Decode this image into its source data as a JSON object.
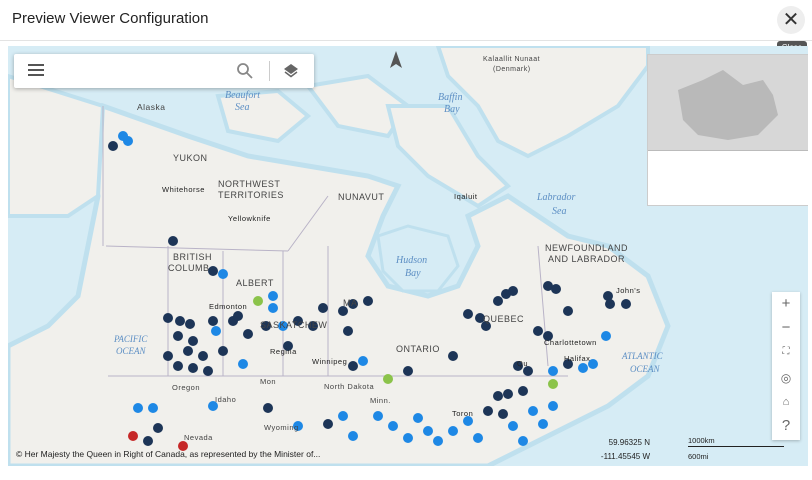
{
  "dialog": {
    "title": "Preview Viewer Configuration",
    "close_icon": "close-icon",
    "close_tooltip": "Close"
  },
  "map": {
    "menu_icon": "hamburger-menu-icon",
    "search_icon": "search-icon",
    "layers_icon": "layers-icon",
    "north_arrow_icon": "north-arrow-icon",
    "attribution": "© Her Majesty the Queen in Right of Canada, as represented by the Minister of...",
    "coordinates": {
      "lat": "59.96325 N",
      "lon": "-111.45545 W"
    },
    "scale": {
      "metric": "1000km",
      "imperial": "600mi"
    },
    "zoom_in_label": "+",
    "zoom_out_label": "−",
    "help_label": "?",
    "labels": {
      "alaska": "Alaska",
      "yukon": "YUKON",
      "whitehorse": "Whitehorse",
      "nwt1": "NORTHWEST",
      "nwt2": "TERRITORIES",
      "nunavut": "NUNAVUT",
      "iqaluit": "Iqaluit",
      "yellowknife": "Yellowknife",
      "bc1": "BRITISH",
      "bc2": "COLUMB",
      "alberta": "ALBERT",
      "edmonton": "Edmonton",
      "sask": "SASKATCHEW",
      "manitoba": "MA",
      "regina": "Regina",
      "winnipeg": "Winnipeg",
      "ontario": "ONTARIO",
      "quebec": "QUEBEC",
      "nl1": "NEWFOUNDLAND",
      "nl2": "AND LABRADOR",
      "johns": "John's",
      "charlottetown": "Charlottetown",
      "halifax": "Halifax",
      "quebec_city": "Qu",
      "montana": "Mon",
      "north_dakota": "North Dakota",
      "minn": "Minn.",
      "idaho": "Idaho",
      "oregon": "Oregon",
      "nevada": "Nevada",
      "wyoming": "Wyoming",
      "toronto": "Toron",
      "kalaallit1": "Kalaallit Nunaat",
      "kalaallit2": "(Denmark)"
    },
    "water_labels": {
      "beaufort1": "Beaufort",
      "beaufort2": "Sea",
      "baffin1": "Baffin",
      "baffin2": "Bay",
      "labrador1": "Labrador",
      "labrador2": "Sea",
      "hudson1": "Hudson",
      "hudson2": "Bay",
      "pacific1": "PACIFIC",
      "pacific2": "OCEAN",
      "atlantic1": "ATLANTIC",
      "atlantic2": "OCEAN"
    },
    "colors": {
      "water": "#d6ecf5",
      "land": "#f1f0ec",
      "marker_dark": "#1d3557",
      "marker_blue": "#1e88e5",
      "marker_green": "#8bc34a"
    }
  }
}
